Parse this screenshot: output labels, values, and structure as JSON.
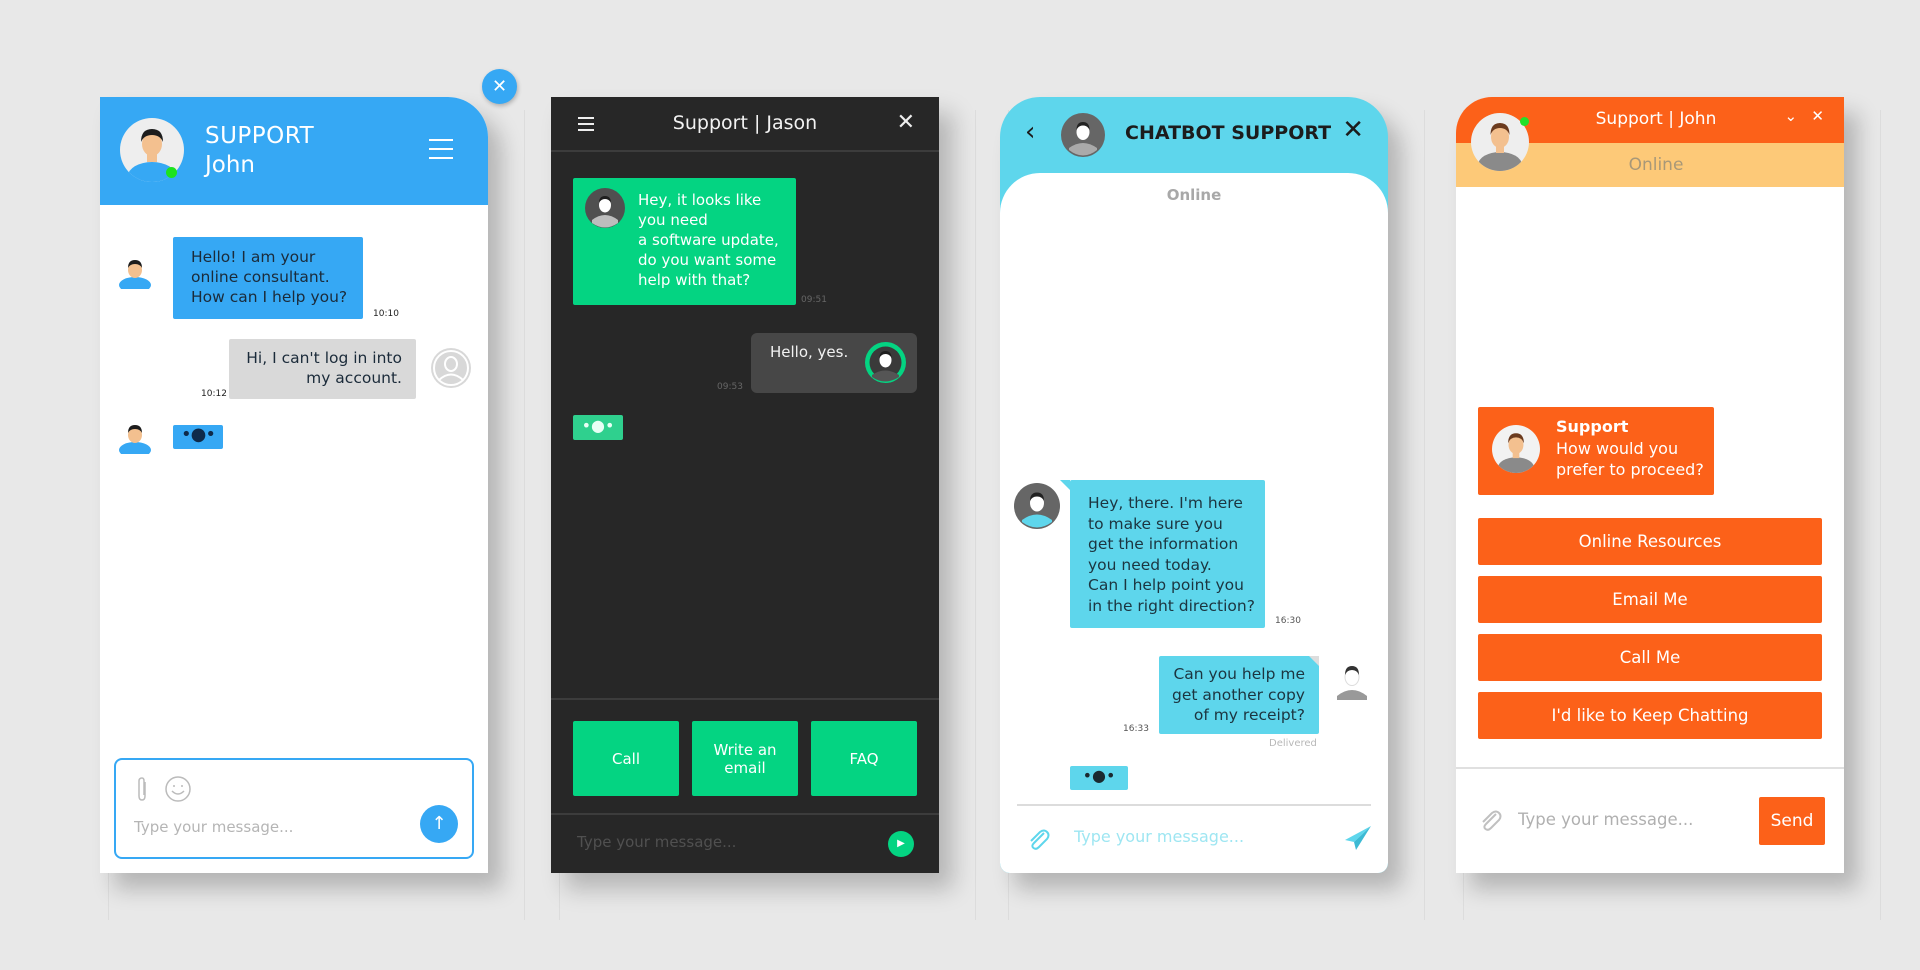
{
  "colors": {
    "background": "#e8e8e8",
    "blue_accent": "#36a8f4",
    "dark_panel": "#272727",
    "green_accent": "#04d482",
    "cyan_accent": "#5ed6ec",
    "orange_accent": "#fc6119",
    "orange_light": "#fdc978",
    "online_dot": "#1de31d"
  },
  "panel1": {
    "header_line1": "SUPPORT",
    "header_line2": "John",
    "close_icon": "close-icon",
    "menu_icon": "hamburger-icon",
    "messages": [
      {
        "sender": "agent",
        "lines": [
          "Hello! I am your",
          "online consultant.",
          "How can I help you?"
        ],
        "time": "10:10"
      },
      {
        "sender": "user",
        "lines": [
          "Hi, I can't log in into",
          "my account."
        ],
        "time": "10:12"
      }
    ],
    "typing_indicator": "•●•",
    "input_placeholder": "Type your message...",
    "attach_icon": "paperclip-icon",
    "emoji_icon": "smiley-icon",
    "send_icon": "↑"
  },
  "panel2": {
    "title": "Support | Jason",
    "menu_icon": "hamburger-icon",
    "close_icon": "✕",
    "messages": [
      {
        "sender": "agent",
        "lines": [
          "Hey, it looks like",
          "you need",
          "a software update,",
          "do you want some",
          "help with that?"
        ],
        "time": "09:51"
      },
      {
        "sender": "user",
        "lines": [
          "Hello, yes."
        ],
        "time": "09:53"
      }
    ],
    "typing_indicator": "•●•",
    "quick_replies": [
      {
        "lines": [
          "Call"
        ]
      },
      {
        "lines": [
          "Write an",
          "email"
        ]
      },
      {
        "lines": [
          "FAQ"
        ]
      }
    ],
    "input_placeholder": "Type your message...",
    "send_icon": "▶"
  },
  "panel3": {
    "title": "CHATBOT SUPPORT",
    "back_icon": "‹",
    "close_icon": "✕",
    "status": "Online",
    "messages": [
      {
        "sender": "bot",
        "lines": [
          "Hey, there. I'm here",
          "to make sure you",
          "get the information",
          "you need today.",
          "Can I help point you",
          "in the right direction?"
        ],
        "time": "16:30"
      },
      {
        "sender": "user",
        "lines": [
          "Can you help me",
          "get another copy",
          "of my receipt?"
        ],
        "time": "16:33",
        "status": "Delivered"
      }
    ],
    "typing_indicator": "•●•",
    "input_placeholder": "Type your message..."
  },
  "panel4": {
    "title": "Support | John",
    "status": "Online",
    "minimize_icon": "⌄",
    "close_icon": "✕",
    "support_bubble": {
      "name": "Support",
      "lines": [
        "How would you",
        "prefer to proceed?"
      ]
    },
    "options": [
      "Online Resources",
      "Email Me",
      "Call Me",
      "I'd like to Keep Chatting"
    ],
    "input_placeholder": "Type your message...",
    "send_label": "Send"
  }
}
